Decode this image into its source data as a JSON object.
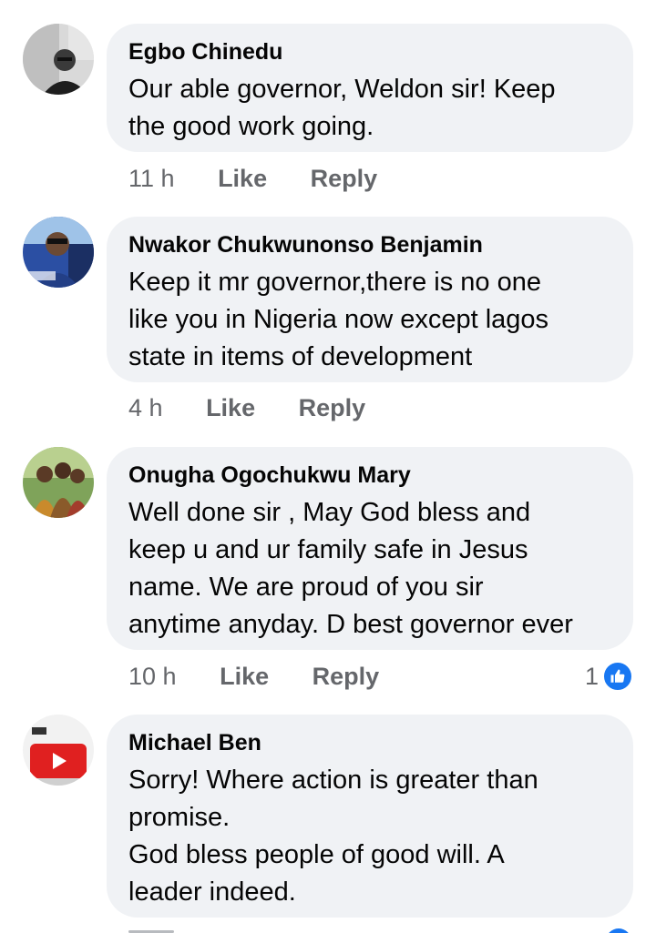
{
  "comments": [
    {
      "author": "Egbo Chinedu",
      "text": "Our able governor, Weldon sir! Keep\nthe good work going.",
      "time": "11 h",
      "like_label": "Like",
      "reply_label": "Reply",
      "reactions": ""
    },
    {
      "author": "Nwakor Chukwunonso Benjamin",
      "text": "Keep it mr governor,there is no one\nlike you in Nigeria now except lagos\nstate in items of development",
      "time": "4 h",
      "like_label": "Like",
      "reply_label": "Reply",
      "reactions": ""
    },
    {
      "author": "Onugha Ogochukwu Mary",
      "text": "Well done sir , May God bless and\nkeep u and ur family safe in Jesus\nname. We are proud of you sir\nanytime anyday. D best governor ever",
      "time": "10 h",
      "like_label": "Like",
      "reply_label": "Reply",
      "reactions": "1"
    },
    {
      "author": "Michael Ben",
      "text": "Sorry! Where action is greater than\n promise.\nGod bless people of good will. A\nleader indeed.",
      "time": "",
      "like_label": "",
      "reply_label": "",
      "reactions": ""
    }
  ],
  "colors": {
    "bubble": "#f0f2f5",
    "meta_text": "#65676b",
    "like_blue": "#1877f2"
  },
  "icons": {
    "reaction": "thumbs-up-icon"
  }
}
